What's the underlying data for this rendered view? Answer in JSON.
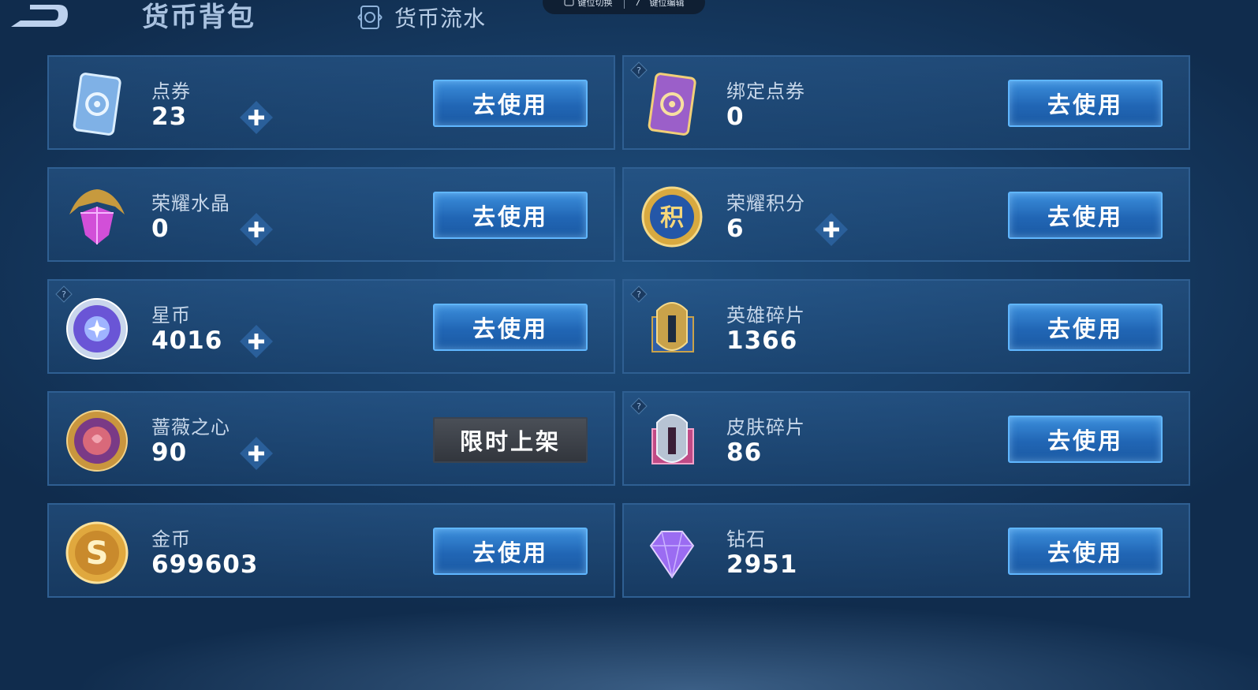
{
  "header": {
    "title": "货币背包",
    "flow_tab": "货币流水",
    "pill": {
      "left": "键位切换",
      "right": "键位编辑"
    }
  },
  "cards": [
    {
      "name": "点券",
      "value": "23",
      "icon": "coupon-blue-icon",
      "button": "去使用",
      "has_plus": true,
      "has_help": false
    },
    {
      "name": "绑定点券",
      "value": "0",
      "icon": "coupon-purple-icon",
      "button": "去使用",
      "has_plus": false,
      "has_help": true
    },
    {
      "name": "荣耀水晶",
      "value": "0",
      "icon": "glory-crystal-icon",
      "button": "去使用",
      "has_plus": true,
      "has_help": false
    },
    {
      "name": "荣耀积分",
      "value": "6",
      "icon": "glory-points-icon",
      "icon_text": "积",
      "button": "去使用",
      "has_plus": true,
      "has_help": false
    },
    {
      "name": "星币",
      "value": "4016",
      "icon": "star-coin-icon",
      "button": "去使用",
      "has_plus": true,
      "has_help": true
    },
    {
      "name": "英雄碎片",
      "value": "1366",
      "icon": "hero-fragment-icon",
      "button": "去使用",
      "has_plus": false,
      "has_help": true
    },
    {
      "name": "蔷薇之心",
      "value": "90",
      "icon": "rose-heart-icon",
      "button": "限时上架",
      "has_plus": true,
      "has_help": false
    },
    {
      "name": "皮肤碎片",
      "value": "86",
      "icon": "skin-fragment-icon",
      "button": "去使用",
      "has_plus": false,
      "has_help": true
    },
    {
      "name": "金币",
      "value": "699603",
      "icon": "gold-coin-icon",
      "button": "去使用",
      "has_plus": false,
      "has_help": false
    },
    {
      "name": "钻石",
      "value": "2951",
      "icon": "diamond-icon",
      "button": "去使用",
      "has_plus": false,
      "has_help": false
    }
  ]
}
